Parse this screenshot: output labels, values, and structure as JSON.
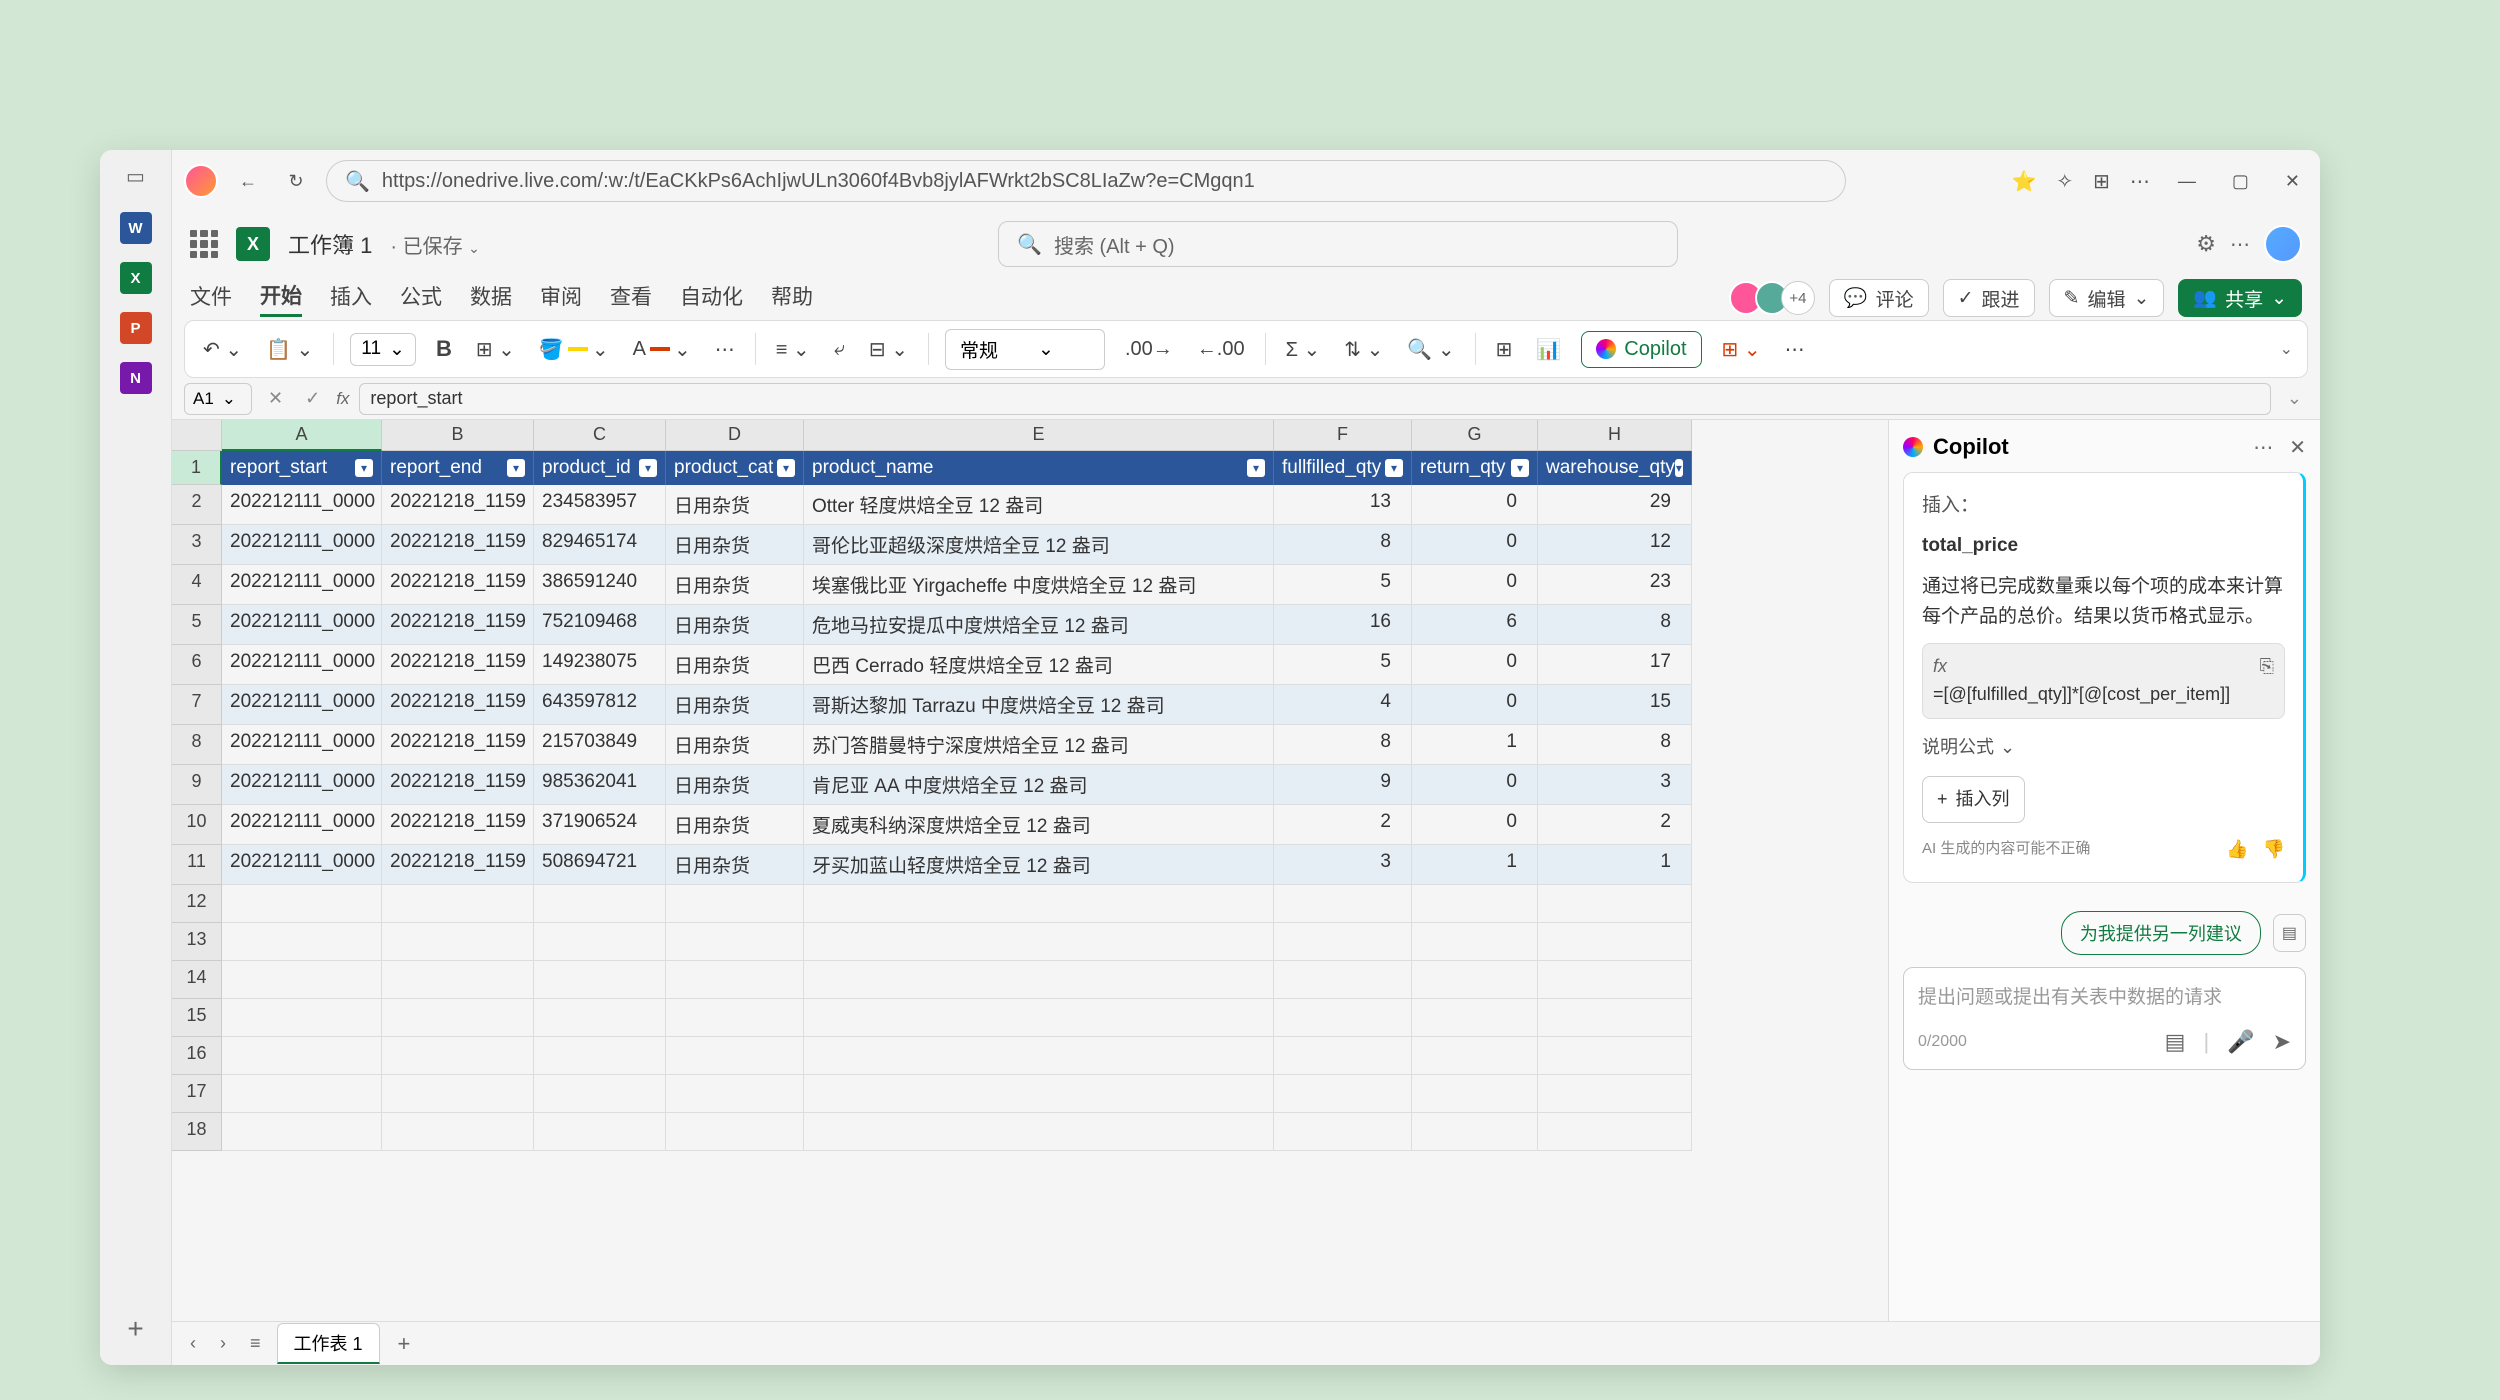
{
  "browser": {
    "url": "https://onedrive.live.com/:w:/t/EaCKkPs6AchIjwULn3060f4Bvb8jylAFWrkt2bSC8LIaZw?e=CMgqn1"
  },
  "rail": {
    "apps": [
      {
        "letter": "W",
        "bg": "#2b579a"
      },
      {
        "letter": "X",
        "bg": "#107c41"
      },
      {
        "letter": "P",
        "bg": "#d24726"
      },
      {
        "letter": "N",
        "bg": "#7719aa"
      }
    ]
  },
  "header": {
    "doc_title": "工作簿 1",
    "save_state": "已保存",
    "search_placeholder": "搜索 (Alt + Q)"
  },
  "ribbon": {
    "tabs": [
      "文件",
      "开始",
      "插入",
      "公式",
      "数据",
      "审阅",
      "查看",
      "自动化",
      "帮助"
    ],
    "active": 1,
    "presence_more": "+4",
    "comments": "评论",
    "track": "跟进",
    "edit": "编辑",
    "share": "共享"
  },
  "toolbar": {
    "font_size": "11",
    "number_format": "常规",
    "copilot": "Copilot"
  },
  "formula": {
    "cell": "A1",
    "value": "report_start"
  },
  "grid": {
    "cols": [
      "A",
      "B",
      "C",
      "D",
      "E",
      "F",
      "G",
      "H"
    ],
    "headers": [
      "report_start",
      "report_end",
      "product_id",
      "product_cat",
      "product_name",
      "fullfilled_qty",
      "return_qty",
      "warehouse_qty"
    ],
    "rows": [
      [
        "202212111_0000",
        "20221218_1159",
        "234583957",
        "日用杂货",
        "Otter 轻度烘焙全豆 12 盎司",
        "13",
        "0",
        "29"
      ],
      [
        "202212111_0000",
        "20221218_1159",
        "829465174",
        "日用杂货",
        "哥伦比亚超级深度烘焙全豆 12 盎司",
        "8",
        "0",
        "12"
      ],
      [
        "202212111_0000",
        "20221218_1159",
        "386591240",
        "日用杂货",
        "埃塞俄比亚 Yirgacheffe 中度烘焙全豆 12 盎司",
        "5",
        "0",
        "23"
      ],
      [
        "202212111_0000",
        "20221218_1159",
        "752109468",
        "日用杂货",
        "危地马拉安提瓜中度烘焙全豆 12 盎司",
        "16",
        "6",
        "8"
      ],
      [
        "202212111_0000",
        "20221218_1159",
        "149238075",
        "日用杂货",
        "巴西 Cerrado 轻度烘焙全豆 12 盎司",
        "5",
        "0",
        "17"
      ],
      [
        "202212111_0000",
        "20221218_1159",
        "643597812",
        "日用杂货",
        "哥斯达黎加 Tarrazu 中度烘焙全豆 12 盎司",
        "4",
        "0",
        "15"
      ],
      [
        "202212111_0000",
        "20221218_1159",
        "215703849",
        "日用杂货",
        "苏门答腊曼特宁深度烘焙全豆 12 盎司",
        "8",
        "1",
        "8"
      ],
      [
        "202212111_0000",
        "20221218_1159",
        "985362041",
        "日用杂货",
        "肯尼亚 AA 中度烘焙全豆 12 盎司",
        "9",
        "0",
        "3"
      ],
      [
        "202212111_0000",
        "20221218_1159",
        "371906524",
        "日用杂货",
        "夏威夷科纳深度烘焙全豆 12 盎司",
        "2",
        "0",
        "2"
      ],
      [
        "202212111_0000",
        "20221218_1159",
        "508694721",
        "日用杂货",
        "牙买加蓝山轻度烘焙全豆 12 盎司",
        "3",
        "1",
        "1"
      ]
    ],
    "empty_rows": [
      12,
      13,
      14,
      15,
      16,
      17,
      18
    ]
  },
  "copilot": {
    "title": "Copilot",
    "insert_label": "插入：",
    "field_name": "total_price",
    "description": "通过将已完成数量乘以每个项的成本来计算每个产品的总价。结果以货币格式显示。",
    "formula": "=[@[fulfilled_qty]]*[@[cost_per_item]]",
    "explain": "说明公式",
    "insert_col": "插入列",
    "disclaimer": "AI 生成的内容可能不正确",
    "suggest": "为我提供另一列建议",
    "input_placeholder": "提出问题或提出有关表中数据的请求",
    "char_count": "0/2000"
  },
  "sheets": {
    "tab": "工作表 1"
  }
}
